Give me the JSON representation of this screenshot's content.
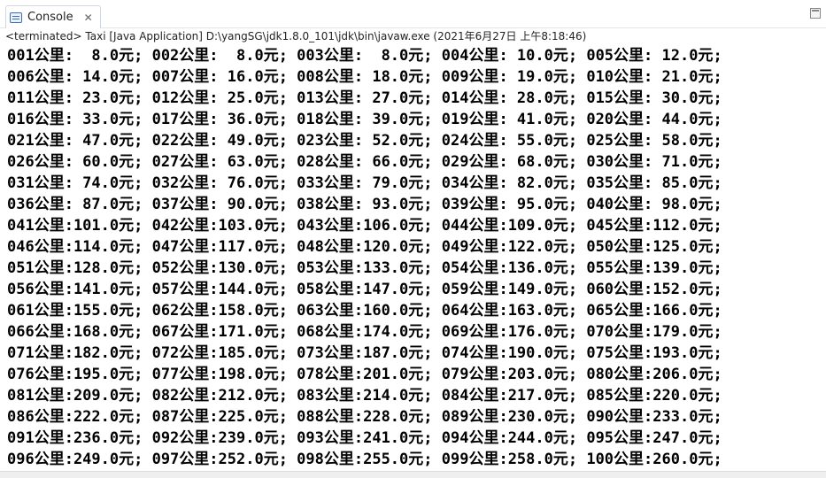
{
  "tab": {
    "label": "Console",
    "close": "✕",
    "icon": "console-icon"
  },
  "status": "<terminated> Taxi [Java Application] D:\\yangSG\\jdk1.8.0_101\\jdk\\bin\\javaw.exe (2021年6月27日 上午8:18:46)",
  "console_lines": [
    "001公里:  8.0元; 002公里:  8.0元; 003公里:  8.0元; 004公里: 10.0元; 005公里: 12.0元;",
    "006公里: 14.0元; 007公里: 16.0元; 008公里: 18.0元; 009公里: 19.0元; 010公里: 21.0元;",
    "011公里: 23.0元; 012公里: 25.0元; 013公里: 27.0元; 014公里: 28.0元; 015公里: 30.0元;",
    "016公里: 33.0元; 017公里: 36.0元; 018公里: 39.0元; 019公里: 41.0元; 020公里: 44.0元;",
    "021公里: 47.0元; 022公里: 49.0元; 023公里: 52.0元; 024公里: 55.0元; 025公里: 58.0元;",
    "026公里: 60.0元; 027公里: 63.0元; 028公里: 66.0元; 029公里: 68.0元; 030公里: 71.0元;",
    "031公里: 74.0元; 032公里: 76.0元; 033公里: 79.0元; 034公里: 82.0元; 035公里: 85.0元;",
    "036公里: 87.0元; 037公里: 90.0元; 038公里: 93.0元; 039公里: 95.0元; 040公里: 98.0元;",
    "041公里:101.0元; 042公里:103.0元; 043公里:106.0元; 044公里:109.0元; 045公里:112.0元;",
    "046公里:114.0元; 047公里:117.0元; 048公里:120.0元; 049公里:122.0元; 050公里:125.0元;",
    "051公里:128.0元; 052公里:130.0元; 053公里:133.0元; 054公里:136.0元; 055公里:139.0元;",
    "056公里:141.0元; 057公里:144.0元; 058公里:147.0元; 059公里:149.0元; 060公里:152.0元;",
    "061公里:155.0元; 062公里:158.0元; 063公里:160.0元; 064公里:163.0元; 065公里:166.0元;",
    "066公里:168.0元; 067公里:171.0元; 068公里:174.0元; 069公里:176.0元; 070公里:179.0元;",
    "071公里:182.0元; 072公里:185.0元; 073公里:187.0元; 074公里:190.0元; 075公里:193.0元;",
    "076公里:195.0元; 077公里:198.0元; 078公里:201.0元; 079公里:203.0元; 080公里:206.0元;",
    "081公里:209.0元; 082公里:212.0元; 083公里:214.0元; 084公里:217.0元; 085公里:220.0元;",
    "086公里:222.0元; 087公里:225.0元; 088公里:228.0元; 089公里:230.0元; 090公里:233.0元;",
    "091公里:236.0元; 092公里:239.0元; 093公里:241.0元; 094公里:244.0元; 095公里:247.0元;",
    "096公里:249.0元; 097公里:252.0元; 098公里:255.0元; 099公里:258.0元; 100公里:260.0元;"
  ]
}
